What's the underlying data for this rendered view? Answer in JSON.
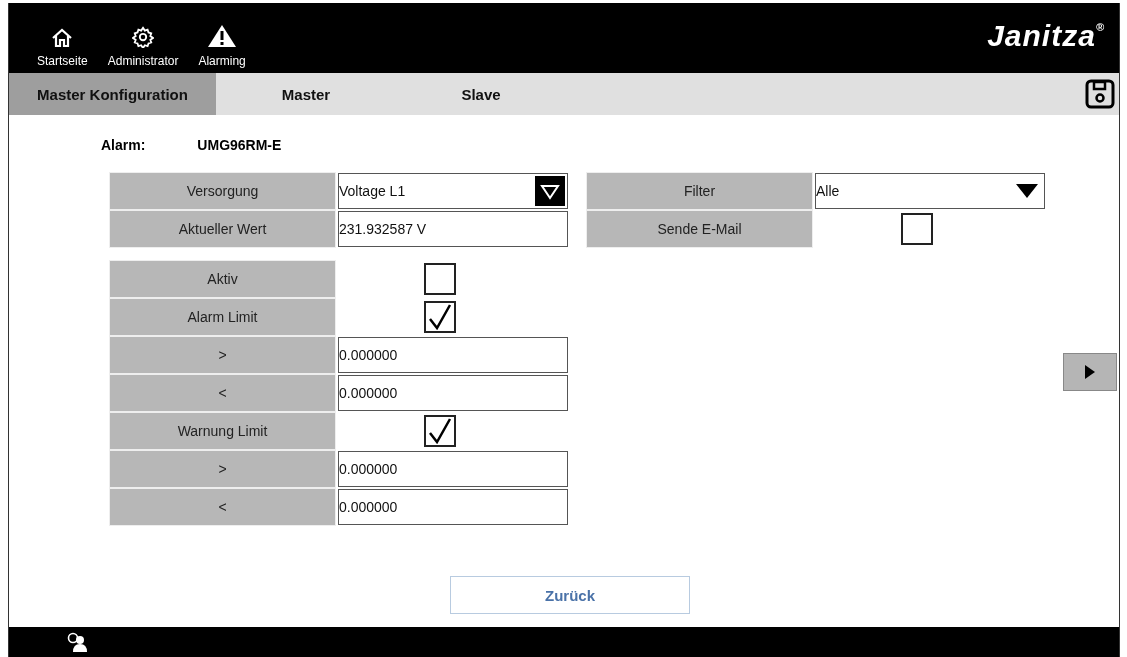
{
  "header": {
    "nav": [
      {
        "label": "Startseite"
      },
      {
        "label": "Administrator"
      },
      {
        "label": "Alarming"
      }
    ],
    "logo": "Janitza",
    "logo_mark": "®"
  },
  "tabs": [
    {
      "label": "Master Konfiguration",
      "selected": true
    },
    {
      "label": "Master",
      "selected": false
    },
    {
      "label": "Slave",
      "selected": false
    }
  ],
  "alarm": {
    "label": "Alarm:",
    "value": "UMG96RM-E"
  },
  "left_top": [
    {
      "label": "Versorgung",
      "kind": "dropdown",
      "value": "Voltage L1"
    },
    {
      "label": "Aktueller Wert",
      "kind": "text",
      "value": "231.932587 V"
    }
  ],
  "right_top": [
    {
      "label": "Filter",
      "kind": "dropdown",
      "value": "Alle"
    },
    {
      "label": "Sende E-Mail",
      "kind": "checkbox",
      "checked": false
    }
  ],
  "limits": [
    {
      "label": "Aktiv",
      "kind": "checkbox",
      "checked": false
    },
    {
      "label": "Alarm Limit",
      "kind": "checkbox",
      "checked": true
    },
    {
      "label": ">",
      "kind": "text",
      "value": "0.000000"
    },
    {
      "label": "<",
      "kind": "text",
      "value": "0.000000"
    },
    {
      "label": "Warnung Limit",
      "kind": "checkbox",
      "checked": true
    },
    {
      "label": ">",
      "kind": "text",
      "value": "0.000000"
    },
    {
      "label": "<",
      "kind": "text",
      "value": "0.000000"
    }
  ],
  "back_button": "Zurück"
}
